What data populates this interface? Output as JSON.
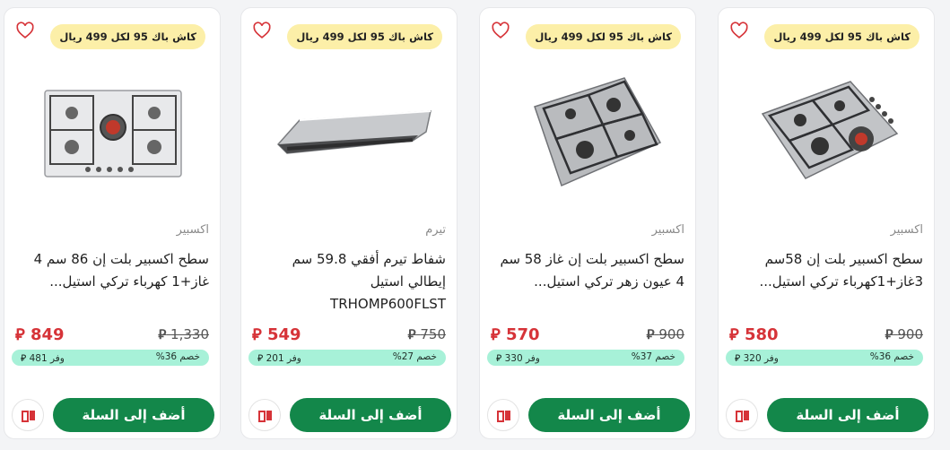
{
  "products": [
    {
      "badge": "كاش باك 95 لكل 499 ريال",
      "brand": "اكسبير",
      "title": "سطح اكسبير بلت إن 86 سم 4 غاز+1 كهرباء تركي استيل...",
      "price": "849",
      "old_price": "1,330",
      "discount": "خصم 36%",
      "save": "وفر 481",
      "cart_label": "أضف إلى السلة",
      "image_icon": "gas-hob-5-burner-icon"
    },
    {
      "badge": "كاش باك 95 لكل 499 ريال",
      "brand": "تيرم",
      "title": "شفاط تيرم أفقي 59.8 سم إيطالي استيل TRHOMP600FLST",
      "price": "549",
      "old_price": "750",
      "discount": "خصم 27%",
      "save": "وفر 201",
      "cart_label": "أضف إلى السلة",
      "image_icon": "range-hood-icon"
    },
    {
      "badge": "كاش باك 95 لكل 499 ريال",
      "brand": "اكسبير",
      "title": "سطح اكسبير بلت إن غاز 58 سم 4 عيون زهر تركي استيل...",
      "price": "570",
      "old_price": "900",
      "discount": "خصم 37%",
      "save": "وفر 330",
      "cart_label": "أضف إلى السلة",
      "image_icon": "gas-hob-4-burner-icon"
    },
    {
      "badge": "كاش باك 95 لكل 499 ريال",
      "brand": "اكسبير",
      "title": "سطح اكسبير بلت إن 58سم 3غاز+1كهرباء تركي استيل...",
      "price": "580",
      "old_price": "900",
      "discount": "خصم 36%",
      "save": "وفر 320",
      "cart_label": "أضف إلى السلة",
      "image_icon": "gas-electric-hob-icon"
    }
  ],
  "colors": {
    "price": "#d63338",
    "cart_button": "#13874a",
    "badge_bg": "#fcefa8",
    "savings_bg": "#a7f1d8"
  }
}
